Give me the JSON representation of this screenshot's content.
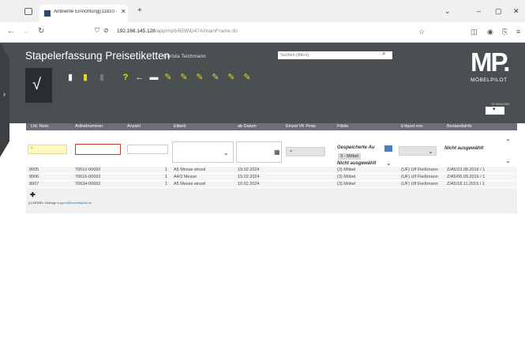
{
  "browser": {
    "tab_title": "Ambiente Einrichtung|(11810 - ",
    "url_host": "192.168.145.128",
    "url_path": "/app/mp6/65WID47A/mainFrame.do"
  },
  "app": {
    "title": "Stapelerfassung Preisetiketten",
    "user": "Christa Teichmann",
    "search_placeholder": "Suchen (Alt+s)",
    "logo_main": "MP.",
    "logo_sub": "MÖBELPILOT",
    "logo_small": "HP WINDOWS",
    "colors": {
      "header": "#4a4f52",
      "grid_header": "#6a7075",
      "error_border": "#d03a2a",
      "accent_yellow": "#f2d21b"
    }
  },
  "grid": {
    "headers": [
      "Lfd. Num.",
      "Artikelnummer",
      "Anzahl",
      "Etikett",
      "ab Datum",
      "Einzel VK Preis",
      "Filiale",
      "Erfasst von",
      "Bestandsinfo"
    ],
    "filter": {
      "lfd": "*",
      "preis": "=",
      "filiale_title": "Gespeicherte Au",
      "filiale_chip": "3 - Möbel",
      "nicht1": "Nicht ausgewählt",
      "nicht2": "Nicht ausgewählt"
    },
    "rows": [
      {
        "lfd": "8905",
        "artnr": "70610-00692",
        "anzahl": "1",
        "etikett": "A5 Messe einzel",
        "datum": "19.02.2024",
        "preis": "",
        "filiale": "(3) Möbel",
        "erfasst": "(UF) Ulf Fleißmann",
        "bestand": "Z/A5/23.08.2016 / 1"
      },
      {
        "lfd": "8906",
        "artnr": "70616-00692",
        "anzahl": "1",
        "etikett": "A4/3 Messe",
        "datum": "19.02.2024",
        "preis": "",
        "filiale": "(3) Möbel",
        "erfasst": "(UF) Ulf Fleißmann",
        "bestand": "Z/A5/06.09.2016 / 1"
      },
      {
        "lfd": "8907",
        "artnr": "70634-00692",
        "anzahl": "1",
        "etikett": "A5 Messe einzel",
        "datum": "19.02.2024",
        "preis": "",
        "filiale": "(3) Möbel",
        "erfasst": "(UF) Ulf Fleißmann",
        "bestand": "Z/A5/18.11.2015 / 1"
      }
    ],
    "footer_prefix": "(c) MÖBEL Hotlinge",
    "footer_link": "support@moebelpilot.de"
  }
}
